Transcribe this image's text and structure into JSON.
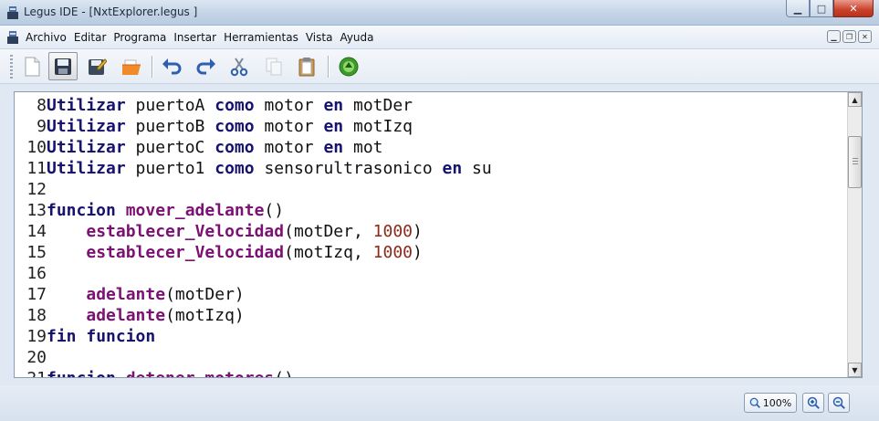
{
  "window": {
    "title": "Legus IDE - [NxtExplorer.legus ]"
  },
  "menu": [
    "Archivo",
    "Editar",
    "Programa",
    "Insertar",
    "Herramientas",
    "Vista",
    "Ayuda"
  ],
  "toolbar": {
    "buttons": [
      {
        "name": "new-file-button",
        "icon": "new-document-icon"
      },
      {
        "name": "save-button",
        "icon": "save-icon"
      },
      {
        "name": "save-as-button",
        "icon": "save-as-icon"
      },
      {
        "name": "open-button",
        "icon": "open-folder-icon"
      },
      {
        "name": "undo-button",
        "icon": "undo-icon"
      },
      {
        "name": "redo-button",
        "icon": "redo-icon"
      },
      {
        "name": "cut-button",
        "icon": "cut-icon"
      },
      {
        "name": "copy-button",
        "icon": "copy-icon"
      },
      {
        "name": "paste-button",
        "icon": "paste-icon"
      },
      {
        "name": "run-button",
        "icon": "run-icon"
      }
    ]
  },
  "editor": {
    "lines": [
      {
        "n": "8",
        "tokens": [
          [
            "kw",
            "Utilizar"
          ],
          [
            "plain",
            " puertoA "
          ],
          [
            "kw",
            "como"
          ],
          [
            "plain",
            " motor "
          ],
          [
            "kw",
            "en"
          ],
          [
            "plain",
            " motDer"
          ]
        ]
      },
      {
        "n": "9",
        "tokens": [
          [
            "kw",
            "Utilizar"
          ],
          [
            "plain",
            " puertoB "
          ],
          [
            "kw",
            "como"
          ],
          [
            "plain",
            " motor "
          ],
          [
            "kw",
            "en"
          ],
          [
            "plain",
            " motIzq"
          ]
        ]
      },
      {
        "n": "10",
        "tokens": [
          [
            "kw",
            "Utilizar"
          ],
          [
            "plain",
            " puertoC "
          ],
          [
            "kw",
            "como"
          ],
          [
            "plain",
            " motor "
          ],
          [
            "kw",
            "en"
          ],
          [
            "plain",
            " mot"
          ]
        ]
      },
      {
        "n": "11",
        "tokens": [
          [
            "kw",
            "Utilizar"
          ],
          [
            "plain",
            " puerto1 "
          ],
          [
            "kw",
            "como"
          ],
          [
            "plain",
            " sensorultrasonico "
          ],
          [
            "kw",
            "en"
          ],
          [
            "plain",
            " su"
          ]
        ]
      },
      {
        "n": "12",
        "tokens": []
      },
      {
        "n": "13",
        "tokens": [
          [
            "kw",
            "funcion"
          ],
          [
            "plain",
            " "
          ],
          [
            "fn",
            "mover_adelante"
          ],
          [
            "plain",
            "()"
          ]
        ]
      },
      {
        "n": "14",
        "tokens": [
          [
            "plain",
            "    "
          ],
          [
            "fn",
            "establecer_Velocidad"
          ],
          [
            "plain",
            "(motDer, "
          ],
          [
            "num",
            "1000"
          ],
          [
            "plain",
            ")"
          ]
        ]
      },
      {
        "n": "15",
        "tokens": [
          [
            "plain",
            "    "
          ],
          [
            "fn",
            "establecer_Velocidad"
          ],
          [
            "plain",
            "(motIzq, "
          ],
          [
            "num",
            "1000"
          ],
          [
            "plain",
            ")"
          ]
        ]
      },
      {
        "n": "16",
        "tokens": []
      },
      {
        "n": "17",
        "tokens": [
          [
            "plain",
            "    "
          ],
          [
            "fn",
            "adelante"
          ],
          [
            "plain",
            "(motDer)"
          ]
        ]
      },
      {
        "n": "18",
        "tokens": [
          [
            "plain",
            "    "
          ],
          [
            "fn",
            "adelante"
          ],
          [
            "plain",
            "(motIzq)"
          ]
        ]
      },
      {
        "n": "19",
        "tokens": [
          [
            "kw",
            "fin"
          ],
          [
            "plain",
            " "
          ],
          [
            "kw",
            "funcion"
          ]
        ]
      },
      {
        "n": "20",
        "tokens": []
      },
      {
        "n": "21",
        "tokens": [
          [
            "kw",
            "funcion"
          ],
          [
            "plain",
            " "
          ],
          [
            "fn",
            "detener_motores"
          ],
          [
            "plain",
            "()"
          ]
        ]
      }
    ]
  },
  "statusbar": {
    "zoom": "100%"
  }
}
